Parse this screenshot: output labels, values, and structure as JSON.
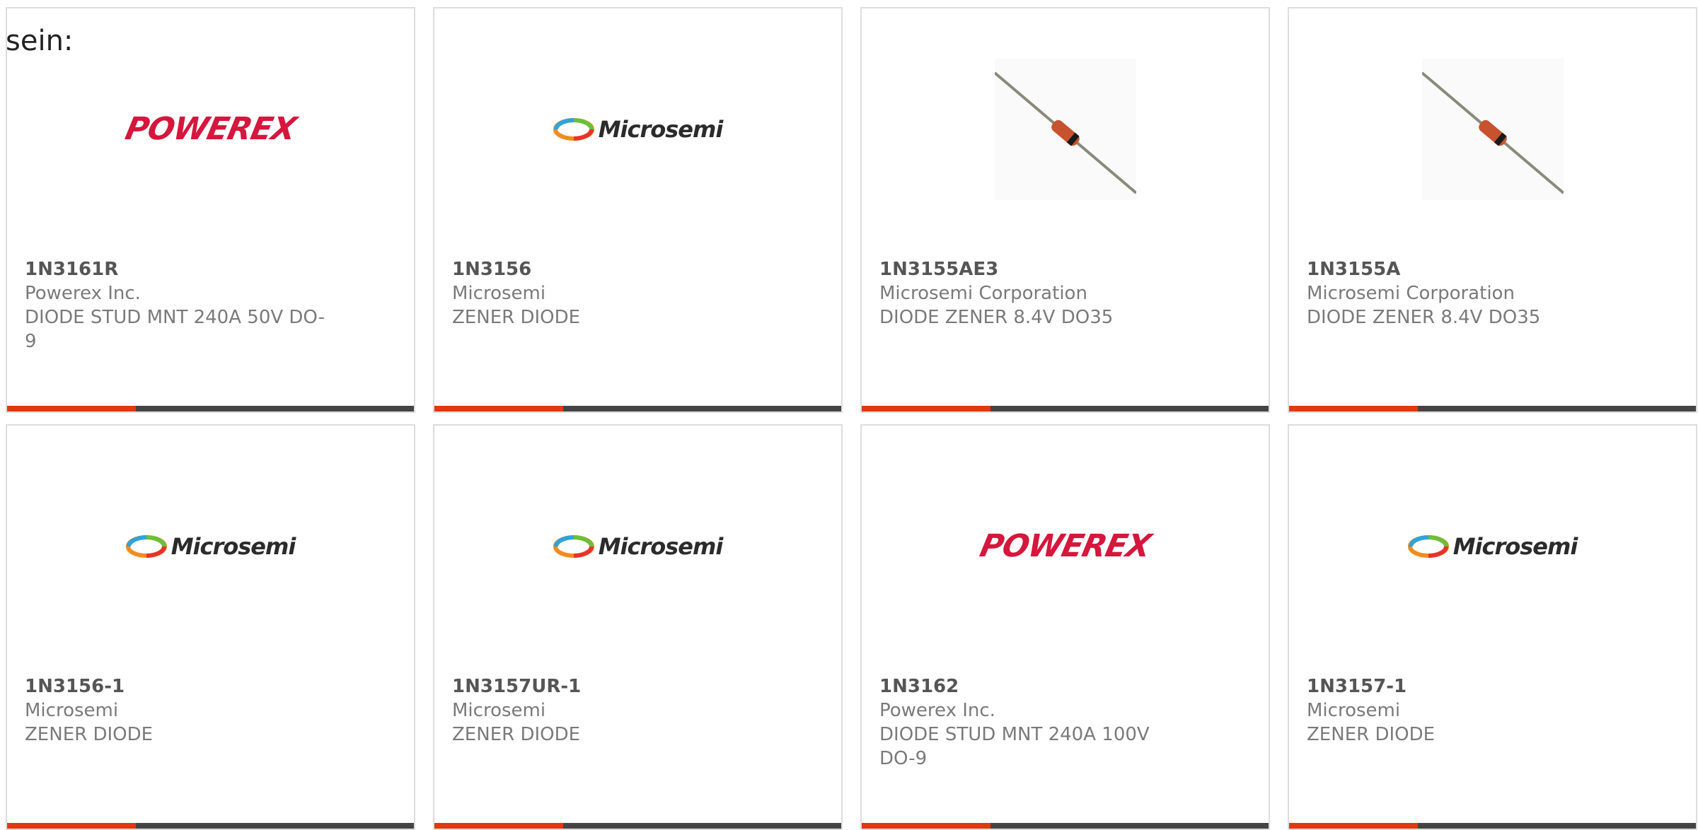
{
  "page": {
    "prefix_text": "sein:"
  },
  "products": [
    {
      "part": "1N3161R",
      "manufacturer": "Powerex Inc.",
      "description": "DIODE STUD MNT 240A 50V DO-9",
      "image": "powerex-logo"
    },
    {
      "part": "1N3156",
      "manufacturer": "Microsemi",
      "description": "ZENER DIODE",
      "image": "microsemi-logo"
    },
    {
      "part": "1N3155AE3",
      "manufacturer": "Microsemi Corporation",
      "description": "DIODE ZENER 8.4V DO35",
      "image": "diode-photo"
    },
    {
      "part": "1N3155A",
      "manufacturer": "Microsemi Corporation",
      "description": "DIODE ZENER 8.4V DO35",
      "image": "diode-photo"
    },
    {
      "part": "1N3156-1",
      "manufacturer": "Microsemi",
      "description": "ZENER DIODE",
      "image": "microsemi-logo"
    },
    {
      "part": "1N3157UR-1",
      "manufacturer": "Microsemi",
      "description": "ZENER DIODE",
      "image": "microsemi-logo"
    },
    {
      "part": "1N3162",
      "manufacturer": "Powerex Inc.",
      "description": "DIODE STUD MNT 240A 100V DO-9",
      "image": "powerex-logo"
    },
    {
      "part": "1N3157-1",
      "manufacturer": "Microsemi",
      "description": "ZENER DIODE",
      "image": "microsemi-logo"
    }
  ],
  "logos": {
    "powerex": "POWEREX",
    "microsemi": "Microsemi"
  },
  "colors": {
    "accent": "#e2380b",
    "bar": "#444444",
    "powerex_red": "#d6163c"
  }
}
